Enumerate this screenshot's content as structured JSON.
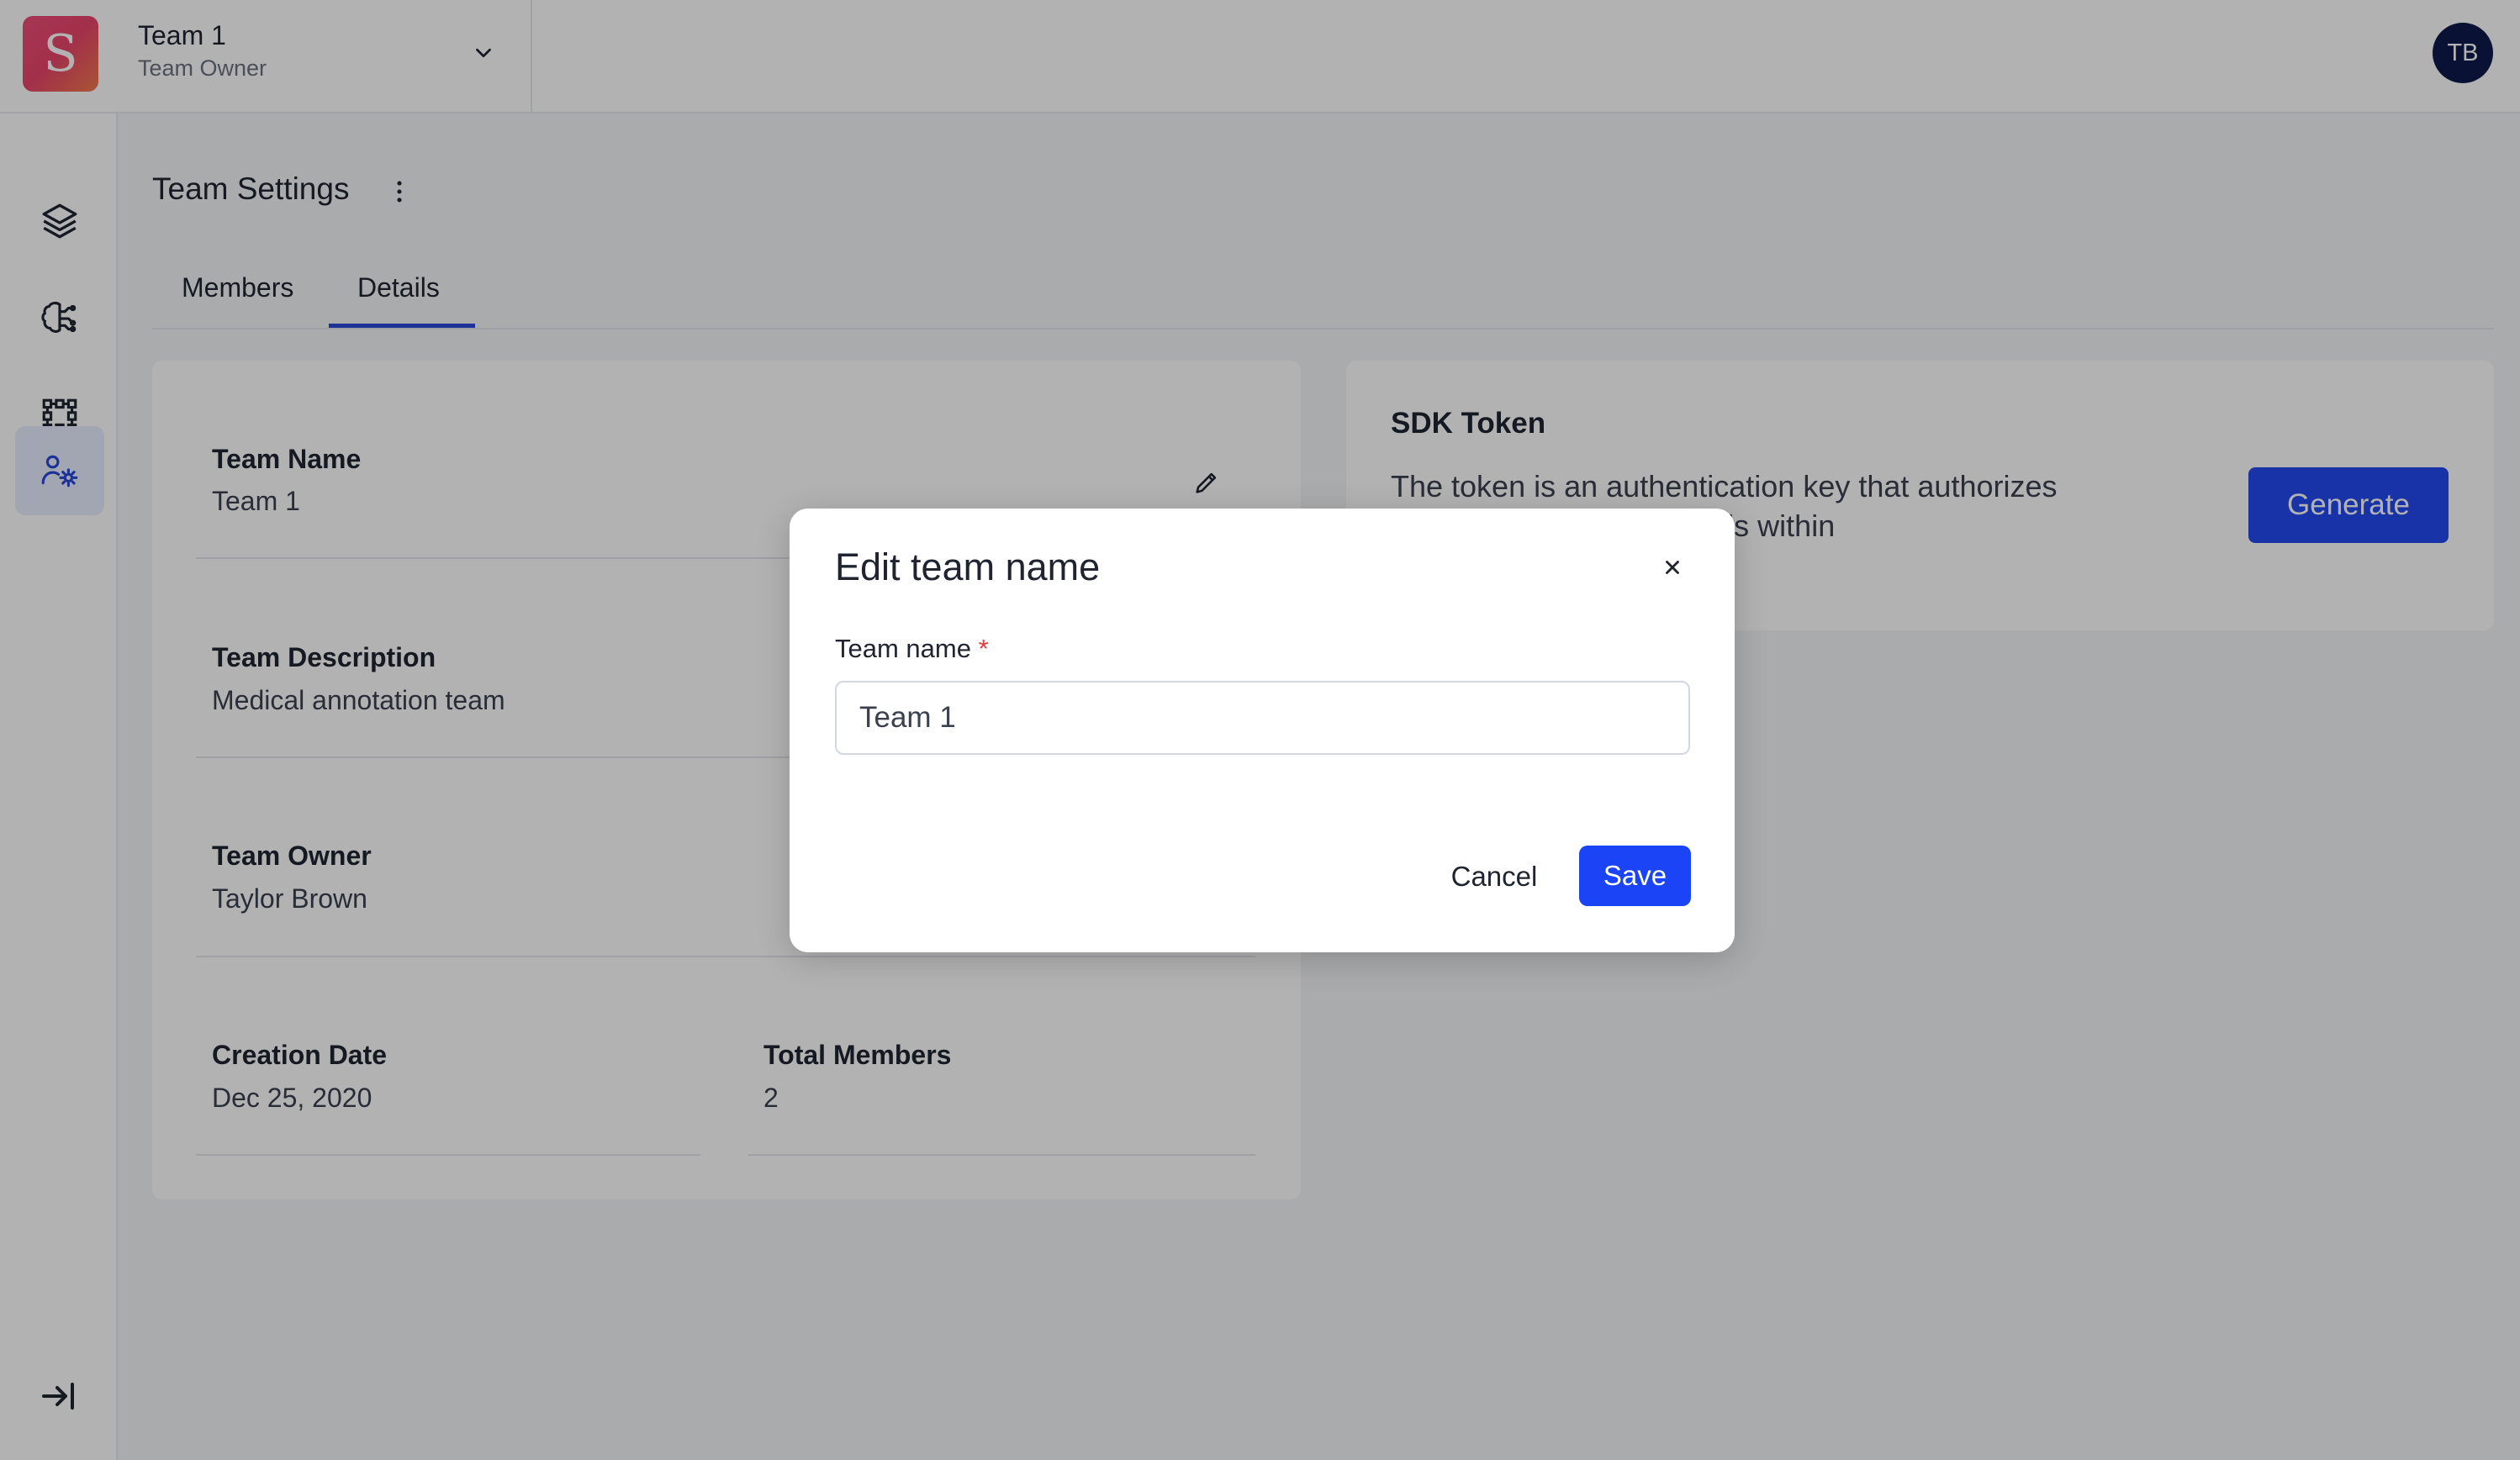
{
  "header": {
    "logo_letter": "S",
    "team_name": "Team 1",
    "team_role": "Team Owner",
    "avatar_initials": "TB"
  },
  "sidebar": {
    "items": [
      {
        "icon": "layers-icon",
        "active": false
      },
      {
        "icon": "brain-icon",
        "active": false
      },
      {
        "icon": "workflow-grid-icon",
        "active": false
      },
      {
        "icon": "team-settings-icon",
        "active": true
      }
    ],
    "collapse_icon": "collapse-sidebar-icon"
  },
  "page": {
    "title": "Team Settings",
    "tabs": [
      {
        "label": "Members",
        "active": false
      },
      {
        "label": "Details",
        "active": true
      }
    ]
  },
  "details": {
    "team_name_label": "Team Name",
    "team_name_value": "Team 1",
    "team_description_label": "Team Description",
    "team_description_value": "Medical annotation team",
    "team_owner_label": "Team Owner",
    "team_owner_value": "Taylor Brown",
    "creation_date_label": "Creation Date",
    "creation_date_value": "Dec 25, 2020",
    "total_members_label": "Total Members",
    "total_members_value": "2"
  },
  "sdk": {
    "title": "SDK Token",
    "description": "The token is an authentication key that authorizes access to various API calls within",
    "generate_label": "Generate"
  },
  "modal": {
    "title": "Edit team name",
    "field_label": "Team name",
    "required_mark": "*",
    "field_value": "Team 1",
    "cancel_label": "Cancel",
    "save_label": "Save"
  },
  "colors": {
    "accent": "#1a44f5",
    "avatar_bg": "#0d1b4c",
    "required": "#e03e3e",
    "overlay": "rgba(0,0,0,0.30)"
  }
}
